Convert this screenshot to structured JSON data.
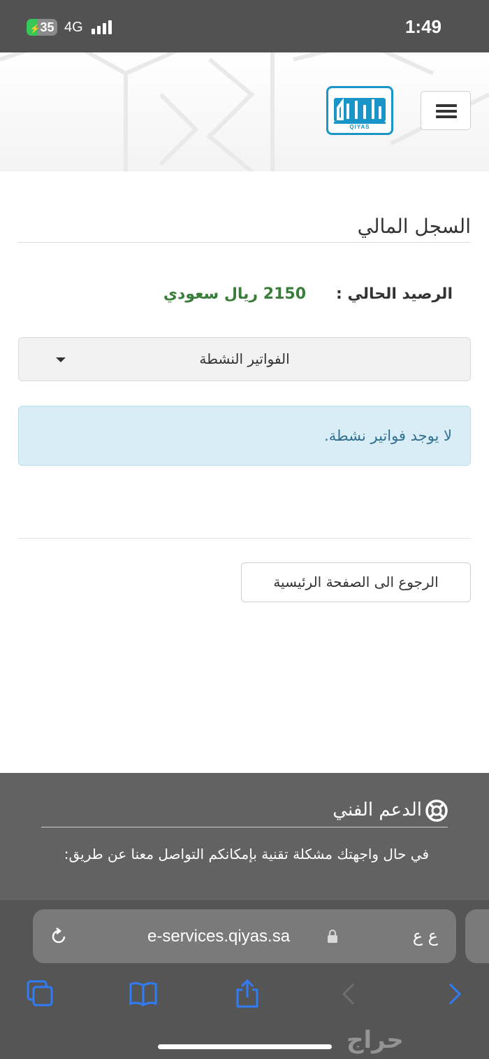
{
  "status_bar": {
    "battery_level": "35",
    "network": "4G",
    "time": "1:49"
  },
  "header": {
    "logo_text": "QIYAS",
    "menu_icon": "hamburger-icon"
  },
  "page": {
    "title": "السجل المالي",
    "balance_label": "الرصيد الحالي :",
    "balance_value": "2150 ريال سعودي",
    "invoice_filter": {
      "selected": "الفواتير النشطة"
    },
    "alert_text": "لا يوجد فواتير نشطة.",
    "back_button": "الرجوع الى الصفحة الرئيسية"
  },
  "footer": {
    "support_title": "الدعم الفني",
    "support_text": "في حال واجهتك مشكلة تقنية بإمكانكم التواصل معنا عن طريق:"
  },
  "browser": {
    "aa_label": "ع ع",
    "url": "e-services.qiyas.sa"
  },
  "watermark": "حراج",
  "colors": {
    "balance_green": "#3a7d3a",
    "alert_bg": "#d9edf7",
    "alert_text": "#31708f",
    "logo_blue": "#1a95c8",
    "ios_blue": "#2f7cf6"
  }
}
